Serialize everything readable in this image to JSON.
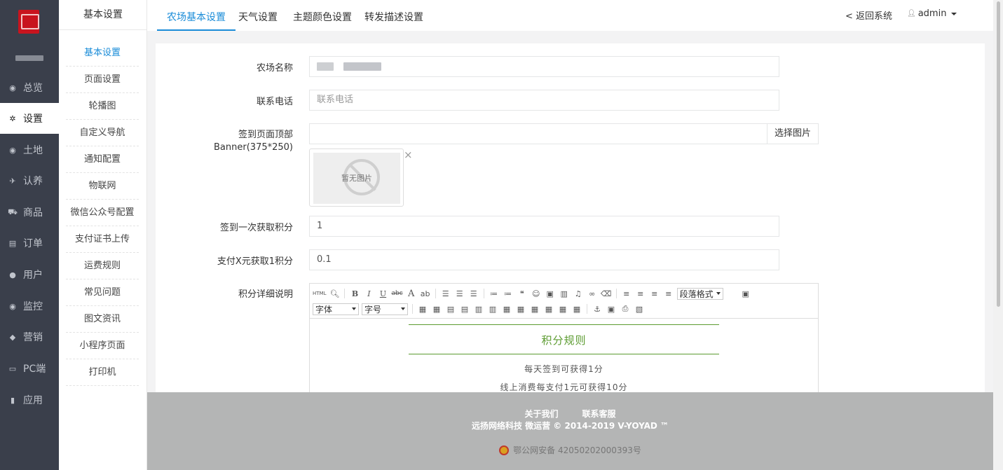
{
  "sidebar": {
    "items": [
      {
        "label": "总览",
        "icon": "globe-icon",
        "glyph": "◉"
      },
      {
        "label": "设置",
        "icon": "gear-icon",
        "glyph": "✲"
      },
      {
        "label": "土地",
        "icon": "globe-icon",
        "glyph": "◉"
      },
      {
        "label": "认养",
        "icon": "bird-icon",
        "glyph": "✈"
      },
      {
        "label": "商品",
        "icon": "cart-icon",
        "glyph": "⛟"
      },
      {
        "label": "订单",
        "icon": "card-icon",
        "glyph": "▤"
      },
      {
        "label": "用户",
        "icon": "user-icon",
        "glyph": "●"
      },
      {
        "label": "监控",
        "icon": "play-circle-icon",
        "glyph": "◉"
      },
      {
        "label": "营销",
        "icon": "tags-icon",
        "glyph": "◆"
      },
      {
        "label": "PC端",
        "icon": "desktop-icon",
        "glyph": "▭"
      },
      {
        "label": "应用",
        "icon": "book-icon",
        "glyph": "▮"
      }
    ]
  },
  "submenu": {
    "title": "基本设置",
    "items": [
      "基本设置",
      "页面设置",
      "轮播图",
      "自定义导航",
      "通知配置",
      "物联网",
      "微信公众号配置",
      "支付证书上传",
      "运费规则",
      "常见问题",
      "图文资讯",
      "小程序页面",
      "打印机"
    ]
  },
  "topbar": {
    "tabs": [
      "农场基本设置",
      "天气设置",
      "主题颜色设置",
      "转发描述设置"
    ],
    "return_label": "< 返回系统",
    "user_label": "admin"
  },
  "form": {
    "name_label": "农场名称",
    "phone_label": "联系电话",
    "phone_placeholder": "联系电话",
    "banner_label_1": "签到页面顶部",
    "banner_label_2": "Banner(375*250)",
    "choose_image": "选择图片",
    "no_image": "暂无图片",
    "close": "×",
    "sign_points_label": "签到一次获取积分",
    "sign_points_value": "1",
    "pay_points_label": "支付X元获取1积分",
    "pay_points_value": "0.1",
    "detail_label": "积分详细说明"
  },
  "editor": {
    "html_btn": "HTML",
    "bold": "B",
    "italic": "I",
    "underline": "U",
    "strike": "abc",
    "font_color": "A",
    "paragraph": "段落格式",
    "font_family": "字体",
    "font_size": "字号",
    "rule_title": "积分规则",
    "rule_1": "每天签到可获得1分",
    "rule_2": "线上消费每支付1元可获得10分"
  },
  "footer": {
    "about": "关于我们",
    "service": "联系客服",
    "copyright": "远扬网络科技 微运营 © 2014-2019 V-YOYAD ™",
    "beian": "鄂公网安备 42050202000393号"
  },
  "colors": {
    "accent": "#1a8cd8",
    "sidebar_bg": "#3a3f4b",
    "rule_green": "#5b9b2f",
    "footer_bg": "#b4b5b5"
  }
}
